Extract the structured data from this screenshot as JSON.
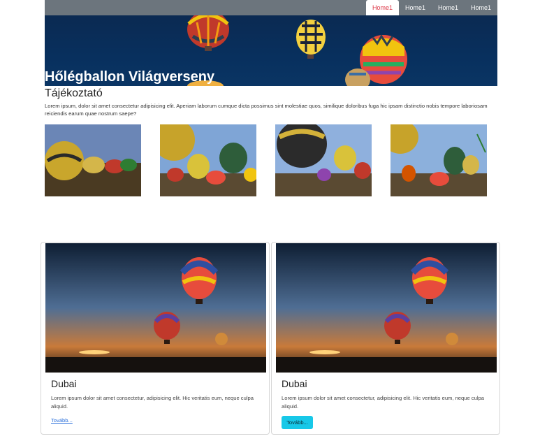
{
  "navbar": {
    "items": [
      {
        "label": "Home1",
        "active": true
      },
      {
        "label": "Home1",
        "active": false
      },
      {
        "label": "Home1",
        "active": false
      },
      {
        "label": "Home1",
        "active": false
      }
    ]
  },
  "hero": {
    "title": "Hőlégballon Világverseny"
  },
  "info": {
    "heading": "Tájékoztató",
    "text": "Lorem ipsum, dolor sit amet consectetur adipisicing elit. Aperiam laborum cumque dicta possimus sint molestiae quos, similique doloribus fuga hic ipsam distinctio nobis tempore laboriosam reiciendis earum quae nostrum saepe?"
  },
  "thumbnails": [
    {
      "icon": "balloon-field-photo"
    },
    {
      "icon": "balloon-field-photo"
    },
    {
      "icon": "balloon-field-photo"
    },
    {
      "icon": "balloon-field-photo"
    }
  ],
  "cards": [
    {
      "title": "Dubai",
      "text": "Lorem ipsum dolor sit amet consectetur, adipisicing elit. Hic veritatis eum, neque culpa aliquid.",
      "action": "Tovább..."
    },
    {
      "title": "Dubai",
      "text": "Lorem ipsum dolor sit amet consectetur, adipisicing elit. Hic veritatis eum, neque culpa aliquid.",
      "action": "Tovább..."
    }
  ],
  "colors": {
    "navbar": "#6c757d",
    "active_link": "#dc3545",
    "link": "#2a6fdb",
    "button": "#17c8e8",
    "hero_sky": "#0b2a52"
  }
}
